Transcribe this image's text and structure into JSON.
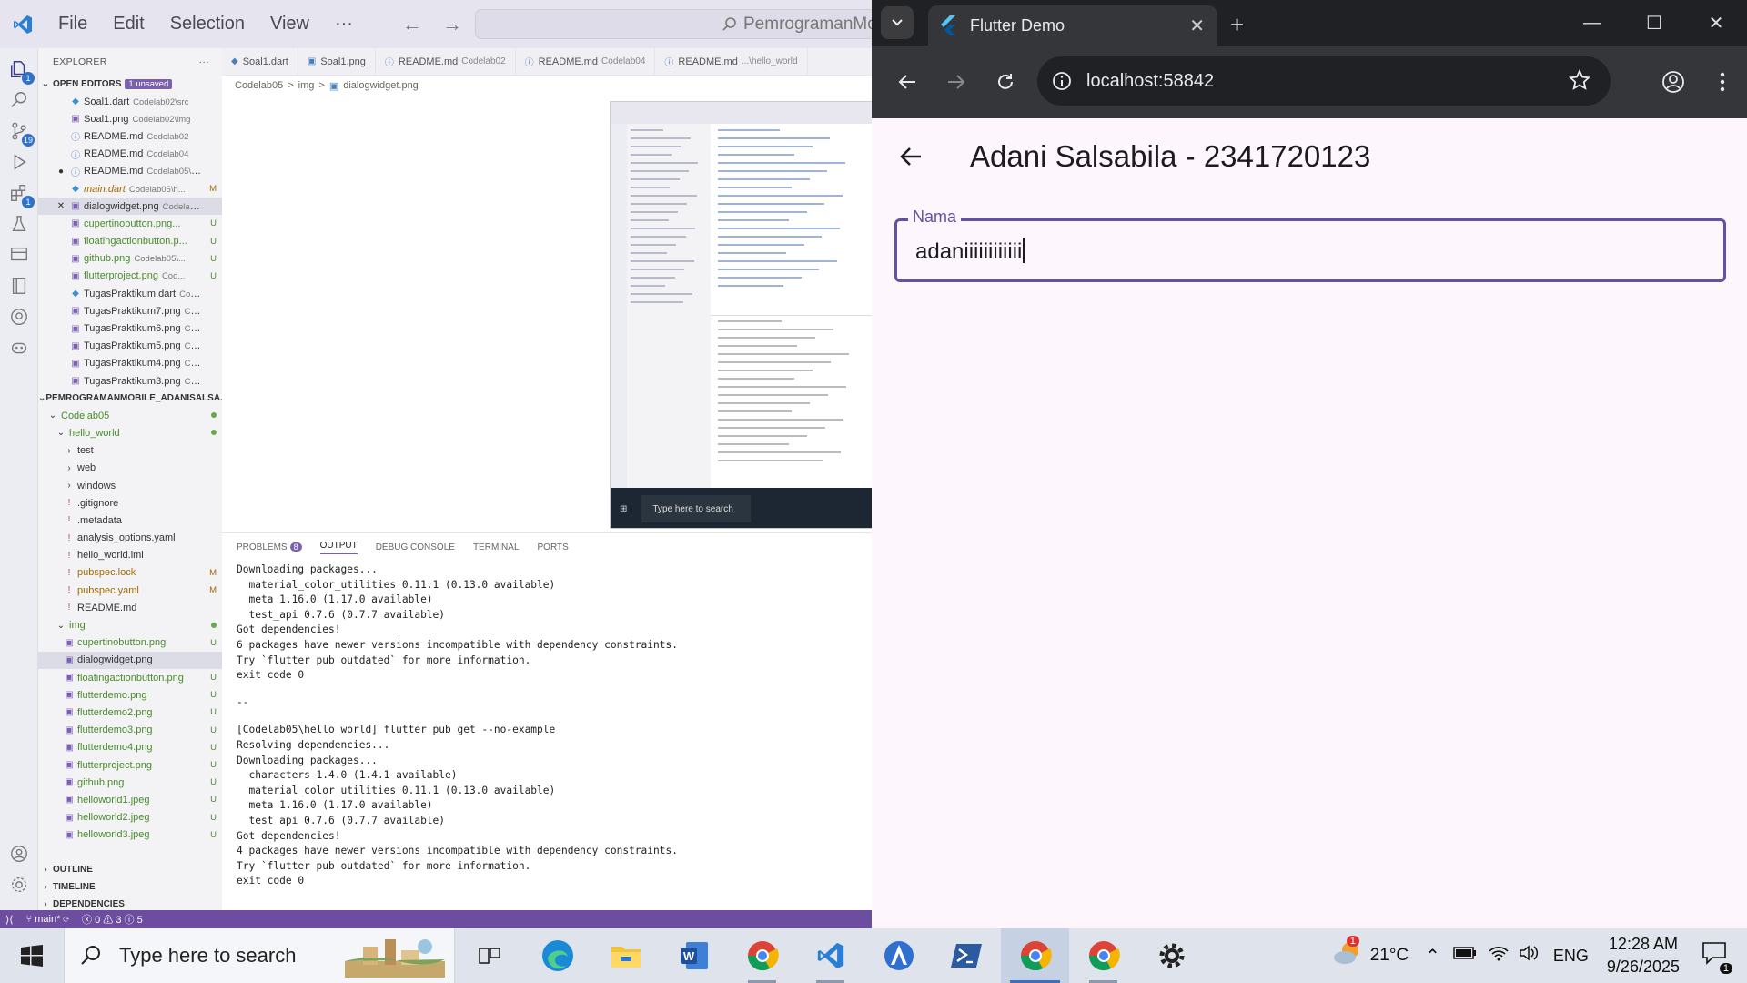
{
  "vscode": {
    "menu": [
      "File",
      "Edit",
      "Selection",
      "View",
      "···"
    ],
    "command_center": "PemrogramanMo",
    "explorer_title": "EXPLORER",
    "explorer_more": "···",
    "open_editors_label": "OPEN EDITORS",
    "unsaved_badge": "1 unsaved",
    "activity_badges": {
      "source_control": "19",
      "extensions": "1",
      "explorer": "1"
    },
    "open_editors": [
      {
        "name": "Soal1.dart",
        "desc": "Codelab02\\src",
        "status": ""
      },
      {
        "name": "Soal1.png",
        "desc": "Codelab02\\img",
        "status": ""
      },
      {
        "name": "README.md",
        "desc": "Codelab02",
        "status": ""
      },
      {
        "name": "README.md",
        "desc": "Codelab04",
        "status": ""
      },
      {
        "name": "README.md",
        "desc": "Codelab05\\hell...",
        "status": ""
      },
      {
        "name": "main.dart",
        "desc": "Codelab05\\h...",
        "status": "M"
      },
      {
        "name": "dialogwidget.png",
        "desc": "Codelab0...",
        "status": ""
      },
      {
        "name": "cupertinobutton.png...",
        "desc": "",
        "status": "U"
      },
      {
        "name": "floatingactionbutton.p...",
        "desc": "",
        "status": "U"
      },
      {
        "name": "github.png",
        "desc": "Codelab05\\...",
        "status": "U"
      },
      {
        "name": "flutterproject.png",
        "desc": "Cod...",
        "status": "U"
      },
      {
        "name": "TugasPraktikum.dart",
        "desc": "Codela...",
        "status": ""
      },
      {
        "name": "TugasPraktikum7.png",
        "desc": "Code...",
        "status": ""
      },
      {
        "name": "TugasPraktikum6.png",
        "desc": "Code...",
        "status": ""
      },
      {
        "name": "TugasPraktikum5.png",
        "desc": "Code...",
        "status": ""
      },
      {
        "name": "TugasPraktikum4.png",
        "desc": "Code...",
        "status": ""
      },
      {
        "name": "TugasPraktikum3.png",
        "desc": "Code...",
        "status": ""
      }
    ],
    "workspace_label": "PEMROGRAMANMOBILE_ADANISALSA...",
    "tree": [
      {
        "name": "Codelab05",
        "indent": 1,
        "kind": "folder-open",
        "status": "dot"
      },
      {
        "name": "hello_world",
        "indent": 2,
        "kind": "folder-open",
        "status": "dot"
      },
      {
        "name": "test",
        "indent": 3,
        "kind": "folder",
        "status": ""
      },
      {
        "name": "web",
        "indent": 3,
        "kind": "folder",
        "status": ""
      },
      {
        "name": "windows",
        "indent": 3,
        "kind": "folder",
        "status": ""
      },
      {
        "name": ".gitignore",
        "indent": 3,
        "kind": "file",
        "status": ""
      },
      {
        "name": ".metadata",
        "indent": 3,
        "kind": "file",
        "status": ""
      },
      {
        "name": "analysis_options.yaml",
        "indent": 3,
        "kind": "file",
        "status": ""
      },
      {
        "name": "hello_world.iml",
        "indent": 3,
        "kind": "file",
        "status": ""
      },
      {
        "name": "pubspec.lock",
        "indent": 3,
        "kind": "file",
        "status": "M"
      },
      {
        "name": "pubspec.yaml",
        "indent": 3,
        "kind": "file",
        "status": "M"
      },
      {
        "name": "README.md",
        "indent": 3,
        "kind": "file",
        "status": ""
      },
      {
        "name": "img",
        "indent": 2,
        "kind": "folder-open",
        "status": "dot"
      },
      {
        "name": "cupertinobutton.png",
        "indent": 3,
        "kind": "img",
        "status": "U"
      },
      {
        "name": "dialogwidget.png",
        "indent": 3,
        "kind": "img",
        "status": ""
      },
      {
        "name": "floatingactionbutton.png",
        "indent": 3,
        "kind": "img",
        "status": "U"
      },
      {
        "name": "flutterdemo.png",
        "indent": 3,
        "kind": "img",
        "status": "U"
      },
      {
        "name": "flutterdemo2.png",
        "indent": 3,
        "kind": "img",
        "status": "U"
      },
      {
        "name": "flutterdemo3.png",
        "indent": 3,
        "kind": "img",
        "status": "U"
      },
      {
        "name": "flutterdemo4.png",
        "indent": 3,
        "kind": "img",
        "status": "U"
      },
      {
        "name": "flutterproject.png",
        "indent": 3,
        "kind": "img",
        "status": "U"
      },
      {
        "name": "github.png",
        "indent": 3,
        "kind": "img",
        "status": "U"
      },
      {
        "name": "helloworld1.jpeg",
        "indent": 3,
        "kind": "img",
        "status": "U"
      },
      {
        "name": "helloworld2.jpeg",
        "indent": 3,
        "kind": "img",
        "status": "U"
      },
      {
        "name": "helloworld3.jpeg",
        "indent": 3,
        "kind": "img",
        "status": "U"
      }
    ],
    "bottom_sections": [
      "OUTLINE",
      "TIMELINE",
      "DEPENDENCIES"
    ],
    "tabs": [
      {
        "name": "Soal1.dart",
        "desc": ""
      },
      {
        "name": "Soal1.png",
        "desc": ""
      },
      {
        "name": "README.md",
        "desc": "Codelab02"
      },
      {
        "name": "README.md",
        "desc": "Codelab04"
      },
      {
        "name": "README.md",
        "desc": "...\\hello_world"
      }
    ],
    "breadcrumb": [
      "Codelab05",
      ">",
      "img",
      ">",
      "dialogwidget.png"
    ],
    "preview_search": "Type here to search",
    "panel_tabs": [
      "PROBLEMS",
      "OUTPUT",
      "DEBUG CONSOLE",
      "TERMINAL",
      "PORTS"
    ],
    "problems_count": "8",
    "output_lines": [
      "Downloading packages...",
      "  material_color_utilities 0.11.1 (0.13.0 available)",
      "  meta 1.16.0 (1.17.0 available)",
      "  test_api 0.7.6 (0.7.7 available)",
      "Got dependencies!",
      "6 packages have newer versions incompatible with dependency constraints.",
      "Try `flutter pub outdated` for more information.",
      "exit code 0",
      "",
      "--",
      "",
      "[Codelab05\\hello_world] flutter pub get --no-example",
      "Resolving dependencies...",
      "Downloading packages...",
      "  characters 1.4.0 (1.4.1 available)",
      "  material_color_utilities 0.11.1 (0.13.0 available)",
      "  meta 1.16.0 (1.17.0 available)",
      "  test_api 0.7.6 (0.7.7 available)",
      "Got dependencies!",
      "4 packages have newer versions incompatible with dependency constraints.",
      "Try `flutter pub outdated` for more information.",
      "exit code 0"
    ],
    "status": {
      "branch": "main*",
      "errors": "0",
      "warnings": "3",
      "info": "5"
    }
  },
  "browser": {
    "tab_title": "Flutter Demo",
    "url": "localhost:58842",
    "app_title": "Adani Salsabila - 2341720123",
    "field_label": "Nama",
    "field_value": "adaniiiiiiiiiiii"
  },
  "taskbar": {
    "search_placeholder": "Type here to search",
    "temperature": "21°C",
    "language": "ENG",
    "time": "12:28 AM",
    "date": "9/26/2025",
    "weather_badge": "1",
    "notification_count": "1"
  },
  "colors": {
    "vscode_status": "#6c4da0",
    "flutter_primary": "#6750a4",
    "chrome_dark": "#202124",
    "taskbar": "#dfe4ec"
  }
}
